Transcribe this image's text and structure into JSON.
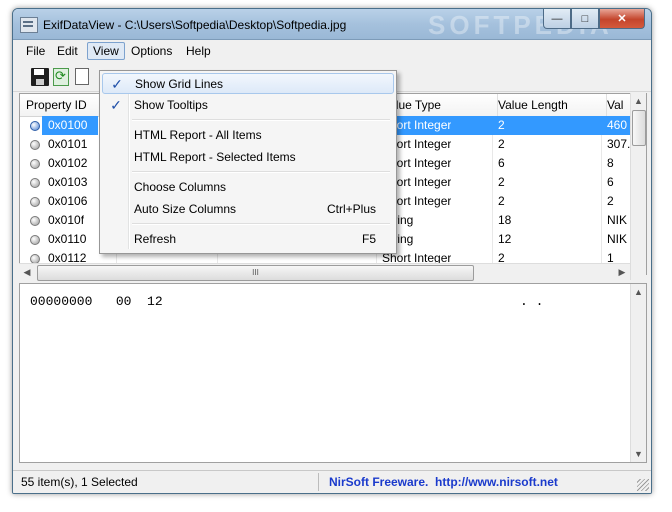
{
  "window": {
    "title": "ExifDataView  -  C:\\Users\\Softpedia\\Desktop\\Softpedia.jpg",
    "watermark": "SOFTPEDIA",
    "min_label": "—",
    "max_label": "□",
    "close_label": "✕"
  },
  "menubar": {
    "file": "File",
    "edit": "Edit",
    "view": "View",
    "options": "Options",
    "help": "Help"
  },
  "list": {
    "columns": [
      "Property ID",
      "Value Type",
      "Value Length",
      "Val"
    ],
    "rows": [
      {
        "id": "0x0100",
        "type": "Short Integer",
        "length": "2",
        "value": "460",
        "selected": true
      },
      {
        "id": "0x0101",
        "type": "Short Integer",
        "length": "2",
        "value": "307."
      },
      {
        "id": "0x0102",
        "type": "Short Integer",
        "length": "6",
        "value": "8"
      },
      {
        "id": "0x0103",
        "type": "Short Integer",
        "length": "2",
        "value": "6"
      },
      {
        "id": "0x0106",
        "type": "Short Integer",
        "length": "2",
        "value": "2"
      },
      {
        "id": "0x010f",
        "type": "String",
        "length": "18",
        "value": "NIK"
      },
      {
        "id": "0x0110",
        "type": "String",
        "length": "12",
        "value": "NIK"
      },
      {
        "id": "0x0112",
        "type": "Short Integer",
        "length": "2",
        "value": "1"
      }
    ],
    "scroll_thumb_glyph": "III"
  },
  "hex": {
    "line": "00000000   00  12",
    "ascii": ". ."
  },
  "status": {
    "count": "55 item(s), 1 Selected",
    "credit": "NirSoft Freeware.  http://www.nirsoft.net"
  },
  "view_menu": {
    "show_grid_lines": "Show Grid Lines",
    "show_tooltips": "Show Tooltips",
    "html_all": "HTML Report - All Items",
    "html_selected": "HTML Report - Selected Items",
    "choose_columns": "Choose Columns",
    "auto_size": "Auto Size Columns",
    "auto_size_shortcut": "Ctrl+Plus",
    "refresh": "Refresh",
    "refresh_shortcut": "F5",
    "checkmark": "✓"
  },
  "colors": {
    "selection": "#3399ff",
    "credit_text": "#1a3acc"
  }
}
